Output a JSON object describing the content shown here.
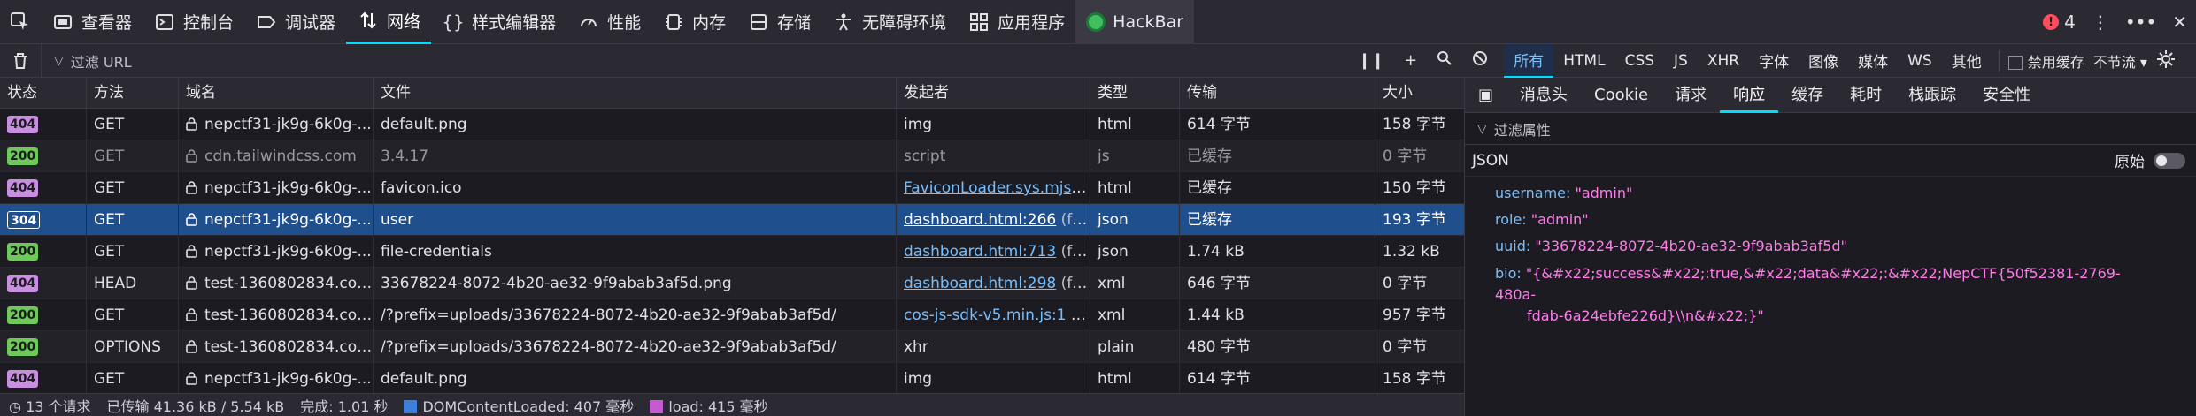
{
  "toolbar": {
    "tabs": [
      {
        "label": "查看器",
        "icon": "inspector-icon"
      },
      {
        "label": "控制台",
        "icon": "console-icon"
      },
      {
        "label": "调试器",
        "icon": "debugger-icon"
      },
      {
        "label": "网络",
        "icon": "network-icon",
        "active": true
      },
      {
        "label": "样式编辑器",
        "icon": "style-editor-icon"
      },
      {
        "label": "性能",
        "icon": "performance-icon"
      },
      {
        "label": "内存",
        "icon": "memory-icon"
      },
      {
        "label": "存储",
        "icon": "storage-icon"
      },
      {
        "label": "无障碍环境",
        "icon": "accessibility-icon"
      },
      {
        "label": "应用程序",
        "icon": "application-icon"
      },
      {
        "label": "HackBar",
        "icon": "hackbar-icon"
      }
    ],
    "error_count": "4"
  },
  "filterbar": {
    "placeholder": "过滤 URL",
    "type_filters": [
      "所有",
      "HTML",
      "CSS",
      "JS",
      "XHR",
      "字体",
      "图像",
      "媒体",
      "WS",
      "其他"
    ],
    "disable_cache_label": "禁用缓存",
    "throttle_label": "不节流"
  },
  "table": {
    "headers": {
      "status": "状态",
      "method": "方法",
      "domain": "域名",
      "file": "文件",
      "initiator": "发起者",
      "type": "类型",
      "transferred": "传输",
      "size": "大小"
    },
    "rows": [
      {
        "status": "404",
        "method": "GET",
        "domain": "nepctf31-jk9g-6k0g-...",
        "file": "default.png",
        "initiator": "img",
        "init_trail": "",
        "type": "html",
        "transferred": "614 字节",
        "size": "158 字节"
      },
      {
        "status": "200",
        "method": "GET",
        "domain": "cdn.tailwindcss.com",
        "file": "3.4.17",
        "initiator": "script",
        "init_trail": "",
        "type": "js",
        "transferred": "已缓存",
        "size": "0 字节"
      },
      {
        "status": "404",
        "method": "GET",
        "domain": "nepctf31-jk9g-6k0g-...",
        "file": "favicon.ico",
        "initiator": "FaviconLoader.sys.mjs:1...",
        "init_trail": "",
        "type": "html",
        "transferred": "已缓存",
        "size": "150 字节"
      },
      {
        "status": "304",
        "method": "GET",
        "domain": "nepctf31-jk9g-6k0g-...",
        "file": "user",
        "initiator": "dashboard.html:266",
        "init_trail": " (fet...",
        "type": "json",
        "transferred": "已缓存",
        "size": "193 字节"
      },
      {
        "status": "200",
        "method": "GET",
        "domain": "nepctf31-jk9g-6k0g-...",
        "file": "file-credentials",
        "initiator": "dashboard.html:713",
        "init_trail": " (fet...",
        "type": "json",
        "transferred": "1.74 kB",
        "size": "1.32 kB"
      },
      {
        "status": "404",
        "method": "HEAD",
        "domain": "test-1360802834.cos....",
        "file": "33678224-8072-4b20-ae32-9f9abab3af5d.png",
        "initiator": "dashboard.html:298",
        "init_trail": " (fet...",
        "type": "xml",
        "transferred": "646 字节",
        "size": "0 字节"
      },
      {
        "status": "200",
        "method": "GET",
        "domain": "test-1360802834.cos....",
        "file": "/?prefix=uploads/33678224-8072-4b20-ae32-9f9abab3af5d/",
        "initiator": "cos-js-sdk-v5.min.js:1",
        "init_trail": " (x...",
        "type": "xml",
        "transferred": "1.44 kB",
        "size": "957 字节"
      },
      {
        "status": "200",
        "method": "OPTIONS",
        "domain": "test-1360802834.cos....",
        "file": "/?prefix=uploads/33678224-8072-4b20-ae32-9f9abab3af5d/",
        "initiator": "xhr",
        "init_trail": "",
        "type": "plain",
        "transferred": "480 字节",
        "size": "0 字节"
      },
      {
        "status": "404",
        "method": "GET",
        "domain": "nepctf31-jk9g-6k0g-...",
        "file": "default.png",
        "initiator": "img",
        "init_trail": "",
        "type": "html",
        "transferred": "614 字节",
        "size": "158 字节"
      }
    ]
  },
  "statusbar": {
    "requests": "13 个请求",
    "transferred": "已传输 41.36 kB / 5.54 kB",
    "finish": "完成: 1.01 秒",
    "dom_loaded": "DOMContentLoaded: 407 毫秒",
    "load": "load: 415 毫秒"
  },
  "panel": {
    "tabs": [
      "消息头",
      "Cookie",
      "请求",
      "响应",
      "缓存",
      "耗时",
      "栈跟踪",
      "安全性"
    ],
    "filter_placeholder": "过滤属性",
    "json_label": "JSON",
    "raw_label": "原始",
    "json": {
      "username_key": "username:",
      "username_val": "\"admin\"",
      "role_key": "role:",
      "role_val": "\"admin\"",
      "uuid_key": "uuid:",
      "uuid_val": "\"33678224-8072-4b20-ae32-9f9abab3af5d\"",
      "bio_key": "bio:",
      "bio_val_1": "\"{&#x22;success&#x22;:true,&#x22;data&#x22;:&#x22;NepCTF{50f52381-2769-480a-",
      "bio_val_2": "fdab-6a24ebfe226d}\\\\n&#x22;}\""
    }
  },
  "colors": {
    "accent": "#00ddff",
    "selected_row": "#1f4f8c",
    "status_404": "#c88fe0",
    "status_200": "#6ec85a",
    "json_key": "#75bfff",
    "json_value": "#ff7de9"
  }
}
